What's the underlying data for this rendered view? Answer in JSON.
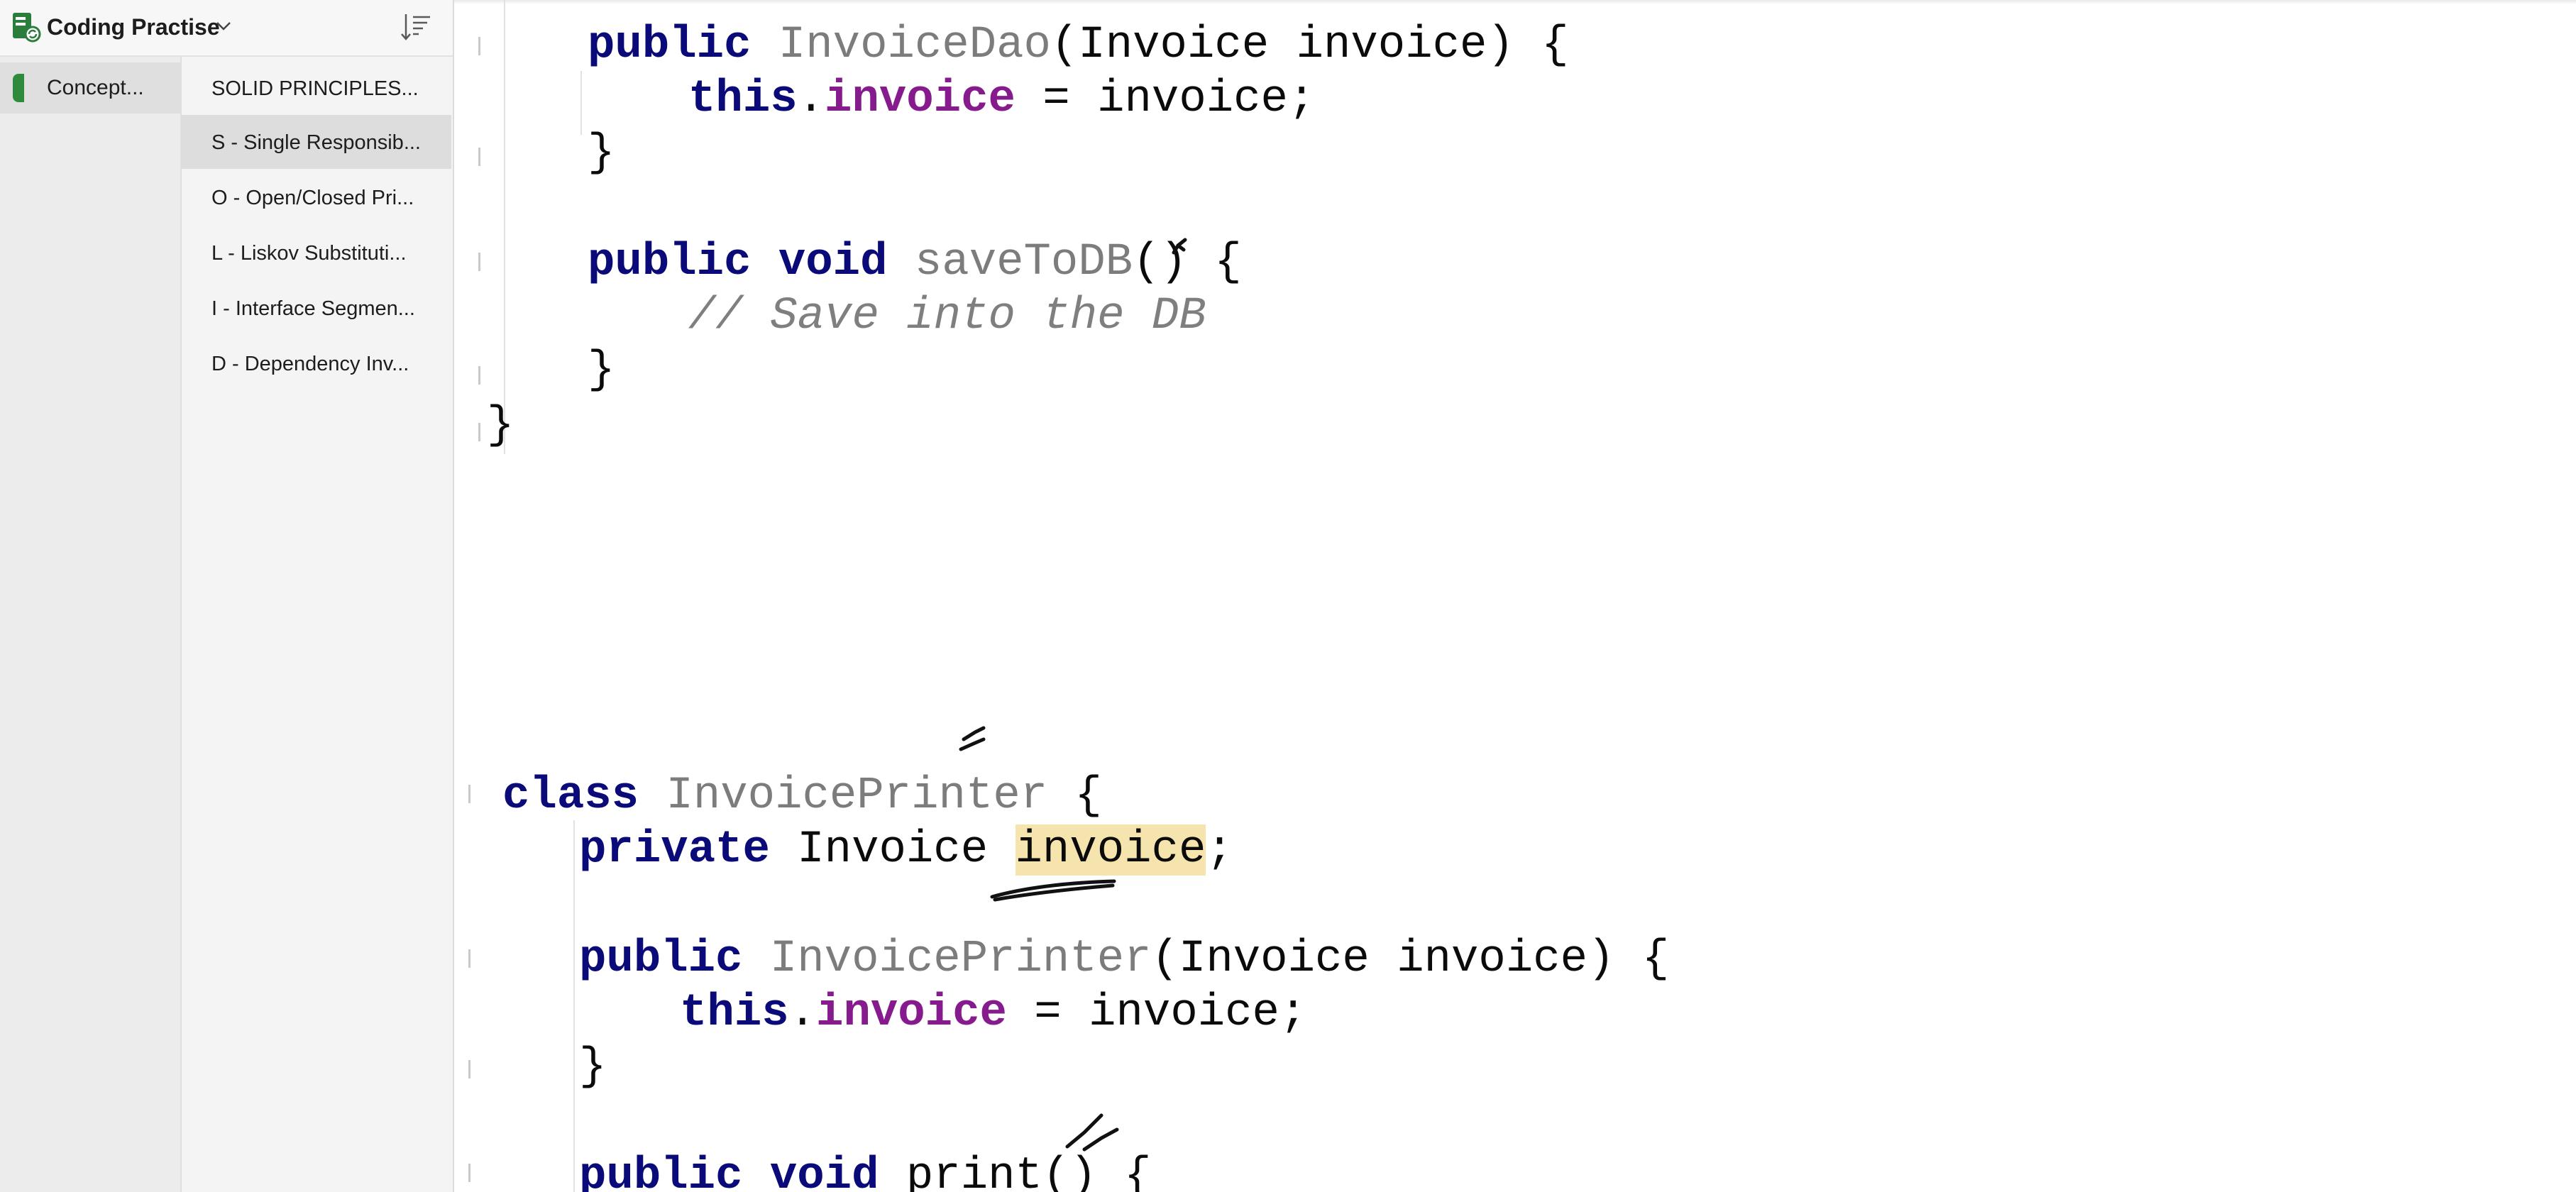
{
  "app": {
    "notebook_title": "Coding Practise",
    "icons": {
      "app": "onenote-notebook-icon",
      "dropdown": "chevron-down-icon",
      "sort": "sort-icon"
    }
  },
  "sections": [
    {
      "label": "Concept...",
      "color": "#2e8b3e",
      "selected": true
    }
  ],
  "pages": [
    {
      "label": "SOLID PRINCIPLES...",
      "selected": false
    },
    {
      "label": "S - Single Responsib...",
      "selected": true
    },
    {
      "label": "O - Open/Closed Pri...",
      "selected": false
    },
    {
      "label": "L - Liskov Substituti...",
      "selected": false
    },
    {
      "label": "I - Interface Segmen...",
      "selected": false
    },
    {
      "label": "D - Dependency Inv...",
      "selected": false
    }
  ],
  "code": {
    "dao_constructor": {
      "kw_public": "public",
      "name": "InvoiceDao",
      "params": "(Invoice invoice) {"
    },
    "dao_assign": {
      "kw_this": "this",
      "dot": ".",
      "field": "invoice",
      "rest": " = invoice;"
    },
    "dao_ctor_close": "}",
    "dao_save": {
      "kw": "public void",
      "name": "saveToDB",
      "rest": "() {"
    },
    "dao_comment": "// Save into the DB",
    "dao_save_close": "}",
    "dao_class_close": "}",
    "printer_class": {
      "kw": "class",
      "name": "InvoicePrinter",
      "rest": " {"
    },
    "printer_field": {
      "kw": "private",
      "type": " Invoice ",
      "name": "invoice",
      "rest": ";"
    },
    "printer_constructor": {
      "kw": "public",
      "name": "InvoicePrinter",
      "params": "(Invoice invoice) {"
    },
    "printer_assign": {
      "kw_this": "this",
      "dot": ".",
      "field": "invoice",
      "rest": " = invoice;"
    },
    "printer_ctor_close": "}",
    "printer_print": {
      "kw": "public void",
      "name": " print() {"
    }
  },
  "colors": {
    "keyword": "#0a0a78",
    "field": "#861b8e",
    "method_name": "#7c7c7c",
    "comment": "#7f7f7f",
    "highlight": "#f5e4ae",
    "section_tab": "#2e8b3e",
    "ink": "#111111"
  }
}
